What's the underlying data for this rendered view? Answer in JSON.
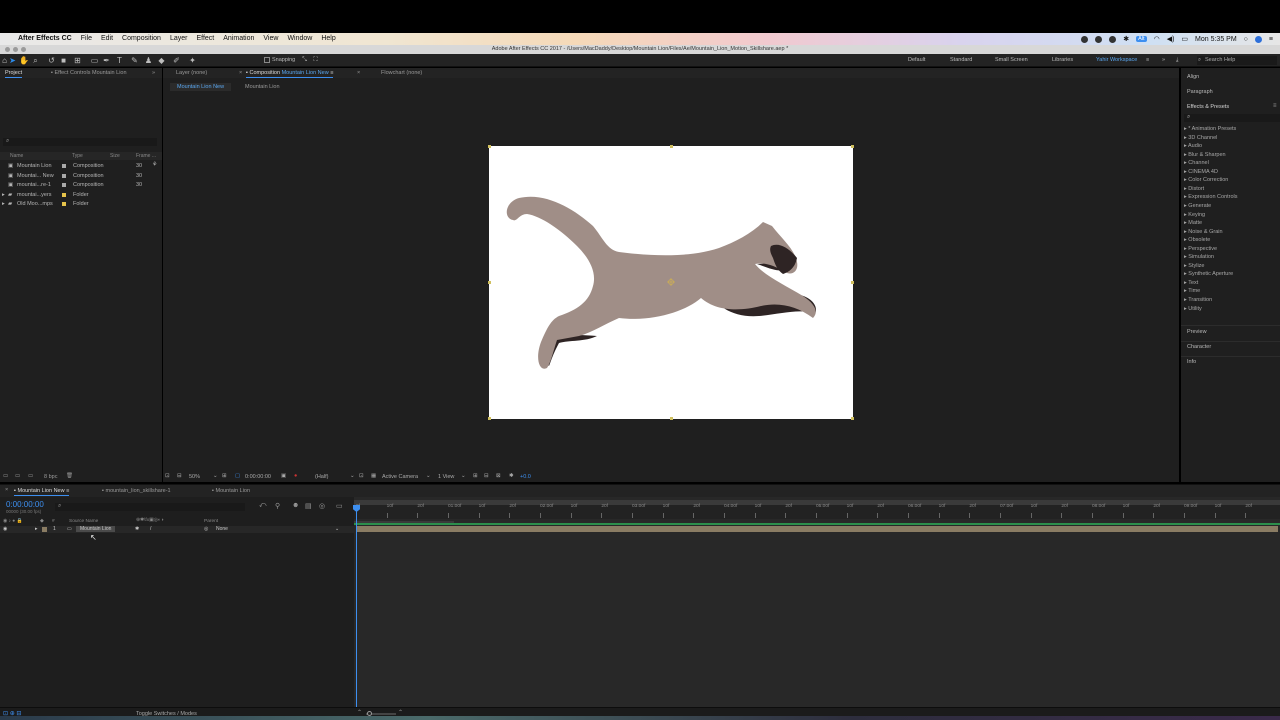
{
  "menubar": {
    "app_name": "After Effects CC",
    "items": [
      "File",
      "Edit",
      "Composition",
      "Layer",
      "Effect",
      "Animation",
      "View",
      "Window",
      "Help"
    ],
    "clock": "Mon 5:35 PM",
    "battery_badge": "Alt"
  },
  "window": {
    "title": "Adobe After Effects CC 2017 - /Users/MacDaddy/Desktop/Mountain Lion/Files/Ae/Mountain_Lion_Motion_Skillshare.aep *"
  },
  "toolbar": {
    "snapping_label": "Snapping",
    "workspaces": [
      "Default",
      "Standard",
      "Small Screen",
      "Libraries",
      "Yahir Workspace"
    ],
    "active_workspace": "Yahir Workspace",
    "help_placeholder": "Search Help"
  },
  "project_panel": {
    "tabs": [
      "Project",
      "Effect Controls Mountain Lion"
    ],
    "columns": [
      "Name",
      "Type",
      "Size",
      "Frame ..."
    ],
    "items": [
      {
        "name": "Mountain Lion",
        "type": "Composition",
        "frame": "30",
        "color": "#a9a9a9"
      },
      {
        "name": "Mountai... New",
        "type": "Composition",
        "frame": "30",
        "color": "#a9a9a9"
      },
      {
        "name": "mountai...re-1",
        "type": "Composition",
        "frame": "30",
        "color": "#a9a9a9"
      },
      {
        "name": "mountai...yers",
        "type": "Folder",
        "frame": "",
        "color": "#e6c34a"
      },
      {
        "name": "Old Moo...mps",
        "type": "Folder",
        "frame": "",
        "color": "#e6c34a"
      }
    ],
    "bpc": "8 bpc"
  },
  "comp_panel": {
    "tabs": [
      "Layer (none)",
      "Composition Mountain Lion New",
      "Flowchart (none)"
    ],
    "comp_tab_prefix": "Composition",
    "comp_tab_name": "Mountain Lion New",
    "breadcrumbs": [
      "Mountain Lion New",
      "Mountain Lion"
    ],
    "zoom": "50%",
    "timecode": "0:00:00:00",
    "resolution": "(Half)",
    "camera": "Active Camera",
    "views": "1 View",
    "exposure": "+0.0"
  },
  "right_panel": {
    "headers_top": [
      "Align",
      "Paragraph",
      "Effects & Presets"
    ],
    "effects": [
      "* Animation Presets",
      "3D Channel",
      "Audio",
      "Blur & Sharpen",
      "Channel",
      "CINEMA 4D",
      "Color Correction",
      "Distort",
      "Expression Controls",
      "Generate",
      "Keying",
      "Matte",
      "Noise & Grain",
      "Obsolete",
      "Perspective",
      "Simulation",
      "Stylize",
      "Synthetic Aperture",
      "Text",
      "Time",
      "Transition",
      "Utility"
    ],
    "headers_bottom": [
      "Preview",
      "Character",
      "Info"
    ]
  },
  "timeline": {
    "tabs": [
      "Mountain Lion New",
      "mountain_lion_skillshare-1",
      "Mountain Lion"
    ],
    "timecode": "0:00:00:00",
    "fps": "00000 (30.00 fps)",
    "columns": {
      "source_name": "Source Name",
      "parent": "Parent"
    },
    "layer": {
      "index": "1",
      "name": "Mountain Lion",
      "parent": "None"
    },
    "ruler": [
      "0f",
      "10f",
      "20f",
      "01:00f",
      "10f",
      "20f",
      "02:00f",
      "10f",
      "20f",
      "03:00f",
      "10f",
      "20f",
      "04:00f",
      "10f",
      "20f",
      "05:00f",
      "10f",
      "20f",
      "06:00f",
      "10f",
      "20f",
      "07:00f",
      "10f",
      "20f",
      "08:00f",
      "10f",
      "20f",
      "09:00f",
      "10f",
      "20f"
    ],
    "toggle_label": "Toggle Switches / Modes"
  },
  "colors": {
    "accent": "#3d8ff0",
    "lion_body": "#a08e87",
    "lion_shadow": "#2e2424",
    "layer_bar": "#8a7c63"
  }
}
